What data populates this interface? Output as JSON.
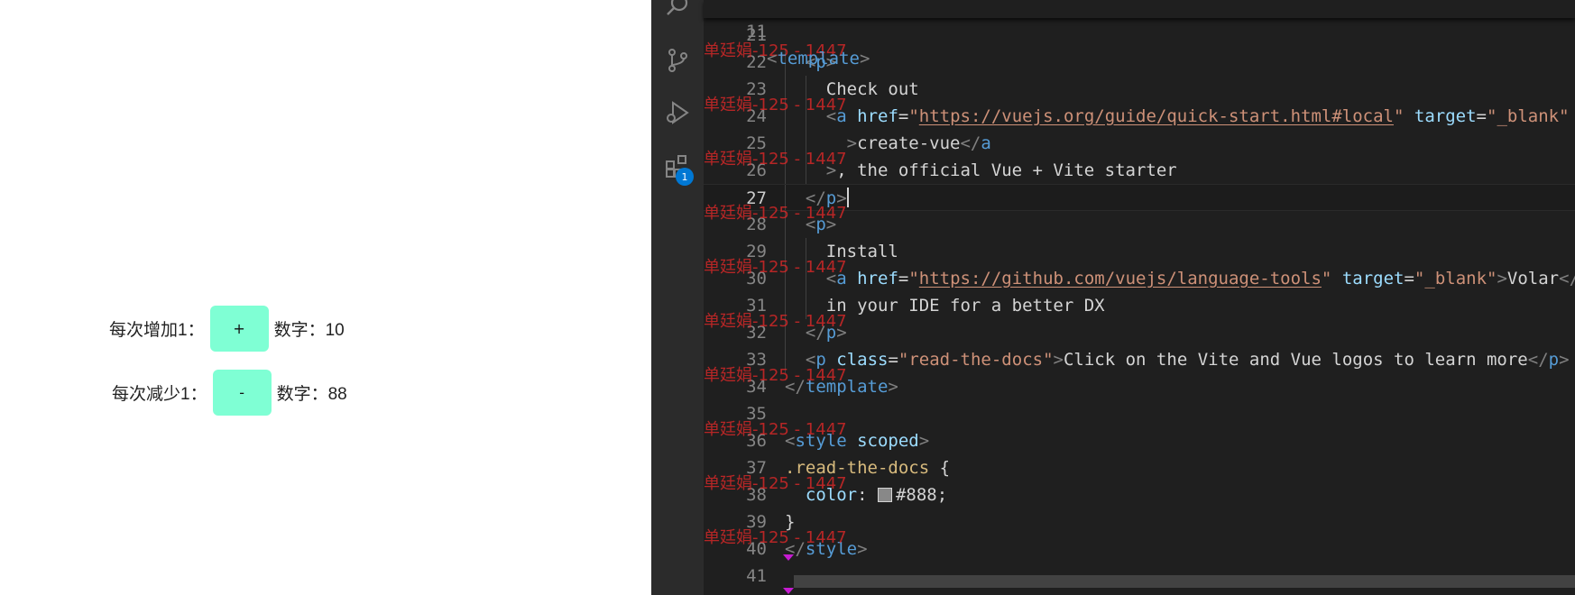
{
  "preview": {
    "increment": {
      "label": "每次增加1：",
      "button": "+",
      "value_text": "数字：10"
    },
    "decrement": {
      "label": "每次减少1：",
      "button": "-",
      "value_text": "数字：88"
    }
  },
  "editor": {
    "extensions_badge": "1",
    "sticky": {
      "number": "11",
      "text": "<template>"
    },
    "watermark_text": "单廷娟-125 - 1447",
    "lines": [
      {
        "n": "21",
        "text": ""
      },
      {
        "n": "22",
        "text": "  <p>"
      },
      {
        "n": "23",
        "text": "    Check out"
      },
      {
        "n": "24",
        "text": "    <a href=\"https://vuejs.org/guide/quick-start.html#local\" target=\"_blank\""
      },
      {
        "n": "25",
        "text": "      >create-vue</a"
      },
      {
        "n": "26",
        "text": "    >, the official Vue + Vite starter"
      },
      {
        "n": "27",
        "text": "  </p>"
      },
      {
        "n": "28",
        "text": "  <p>"
      },
      {
        "n": "29",
        "text": "    Install"
      },
      {
        "n": "30",
        "text": "    <a href=\"https://github.com/vuejs/language-tools\" target=\"_blank\">Volar</a>"
      },
      {
        "n": "31",
        "text": "    in your IDE for a better DX"
      },
      {
        "n": "32",
        "text": "  </p>"
      },
      {
        "n": "33",
        "text": "  <p class=\"read-the-docs\">Click on the Vite and Vue logos to learn more</p>"
      },
      {
        "n": "34",
        "text": "</template>"
      },
      {
        "n": "35",
        "text": ""
      },
      {
        "n": "36",
        "text": "<style scoped>"
      },
      {
        "n": "37",
        "text": ".read-the-docs {"
      },
      {
        "n": "38",
        "text": "  color: #888;"
      },
      {
        "n": "39",
        "text": "}"
      },
      {
        "n": "40",
        "text": "</style>"
      },
      {
        "n": "41",
        "text": ""
      }
    ]
  }
}
